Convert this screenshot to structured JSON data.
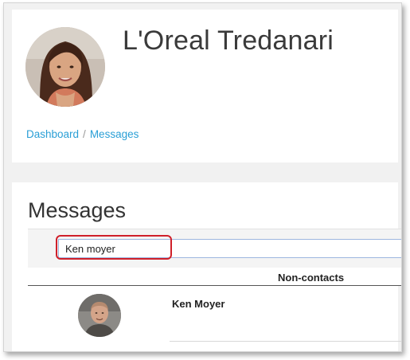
{
  "profile": {
    "name": "L'Oreal Tredanari",
    "avatar": "profile-photo-woman"
  },
  "breadcrumb": {
    "items": [
      "Dashboard",
      "Messages"
    ],
    "separator": "/"
  },
  "messages": {
    "title": "Messages",
    "search": {
      "value": "Ken moyer",
      "placeholder": ""
    },
    "results_header": "Non-contacts",
    "results": [
      {
        "name": "Ken Moyer",
        "avatar": "profile-photo-man"
      }
    ]
  },
  "colors": {
    "link": "#2a9fd6",
    "highlight": "#d0202a",
    "input_border": "#9db6df"
  }
}
